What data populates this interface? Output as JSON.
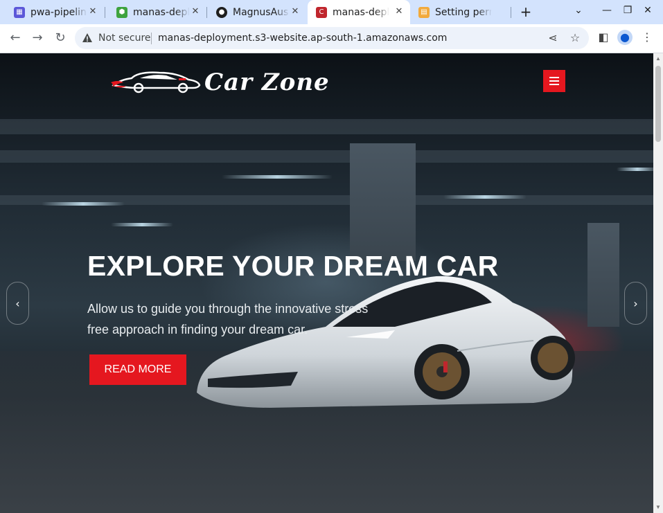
{
  "browser": {
    "tabs": [
      {
        "title": "pwa-pipeline",
        "favicon": "pipeline-icon",
        "color": "#5b57d8"
      },
      {
        "title": "manas-deployment",
        "favicon": "codebuild-icon",
        "color": "#3ea33e"
      },
      {
        "title": "MagnusAus",
        "favicon": "github-icon",
        "color": "#1f1f1f"
      },
      {
        "title": "manas-deployment",
        "favicon": "s3-site-icon",
        "color": "#c0262d"
      },
      {
        "title": "Setting permissions",
        "favicon": "aws-docs-icon",
        "color": "#f2a93b"
      }
    ],
    "active_tab_index": 3,
    "new_tab_label": "+",
    "address": {
      "security_label": "Not secure",
      "url": "manas-deployment.s3-website.ap-south-1.amazonaws.com"
    }
  },
  "site": {
    "logo_text": "Car Zone",
    "hero": {
      "title": "EXPLORE YOUR DREAM CAR",
      "description": "Allow us to guide you through the innovative stress free approach in finding your dream car.",
      "cta_label": "READ MORE"
    },
    "carousel": {
      "prev_label": "‹",
      "next_label": "›"
    },
    "colors": {
      "accent": "#e5171f",
      "hero_text": "#ffffff"
    }
  }
}
